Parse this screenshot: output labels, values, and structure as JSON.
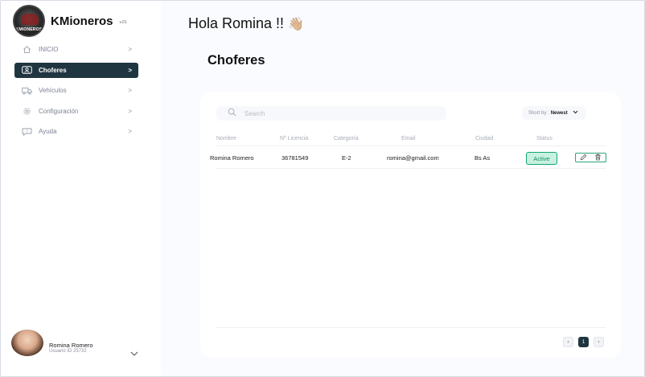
{
  "app": {
    "brand_name": "KMioneros",
    "version": "v.01",
    "logo_text": "KMIONEROS"
  },
  "sidebar": {
    "items": [
      {
        "label": "INICIO",
        "icon": "home-icon",
        "active": false
      },
      {
        "label": "Choferes",
        "icon": "driver-card-icon",
        "active": true
      },
      {
        "label": "Vehículos",
        "icon": "truck-icon",
        "active": false
      },
      {
        "label": "Configuración",
        "icon": "gear-icon",
        "active": false
      },
      {
        "label": "Ayuda",
        "icon": "help-chat-icon",
        "active": false
      }
    ],
    "chevron": ">"
  },
  "user": {
    "name": "Romina Romero",
    "id_text": "Usuario ID 25732"
  },
  "header": {
    "greeting": "Hola Romina !!",
    "wave": "👋🏼"
  },
  "main": {
    "title": "Choferes"
  },
  "toolbar": {
    "search_placeholder": "Search",
    "sort_label": "Short by :",
    "sort_value": "Newest"
  },
  "table": {
    "columns": [
      "Nombre",
      "Nº Licencia",
      "Categoría",
      "Email",
      "Ciudad",
      "Status"
    ],
    "rows": [
      {
        "nombre": "Romina Romero",
        "licencia": "36781549",
        "categoria": "E-2",
        "email": "romina@gmail.com",
        "ciudad": "Bs As",
        "status": "Active"
      }
    ]
  },
  "pagination": {
    "prev": "‹",
    "current": "1",
    "next": "›"
  },
  "colors": {
    "accent": "#1f3641",
    "status_bg": "#c8f1e0",
    "status_border": "#12a579",
    "background": "#fafbff"
  }
}
